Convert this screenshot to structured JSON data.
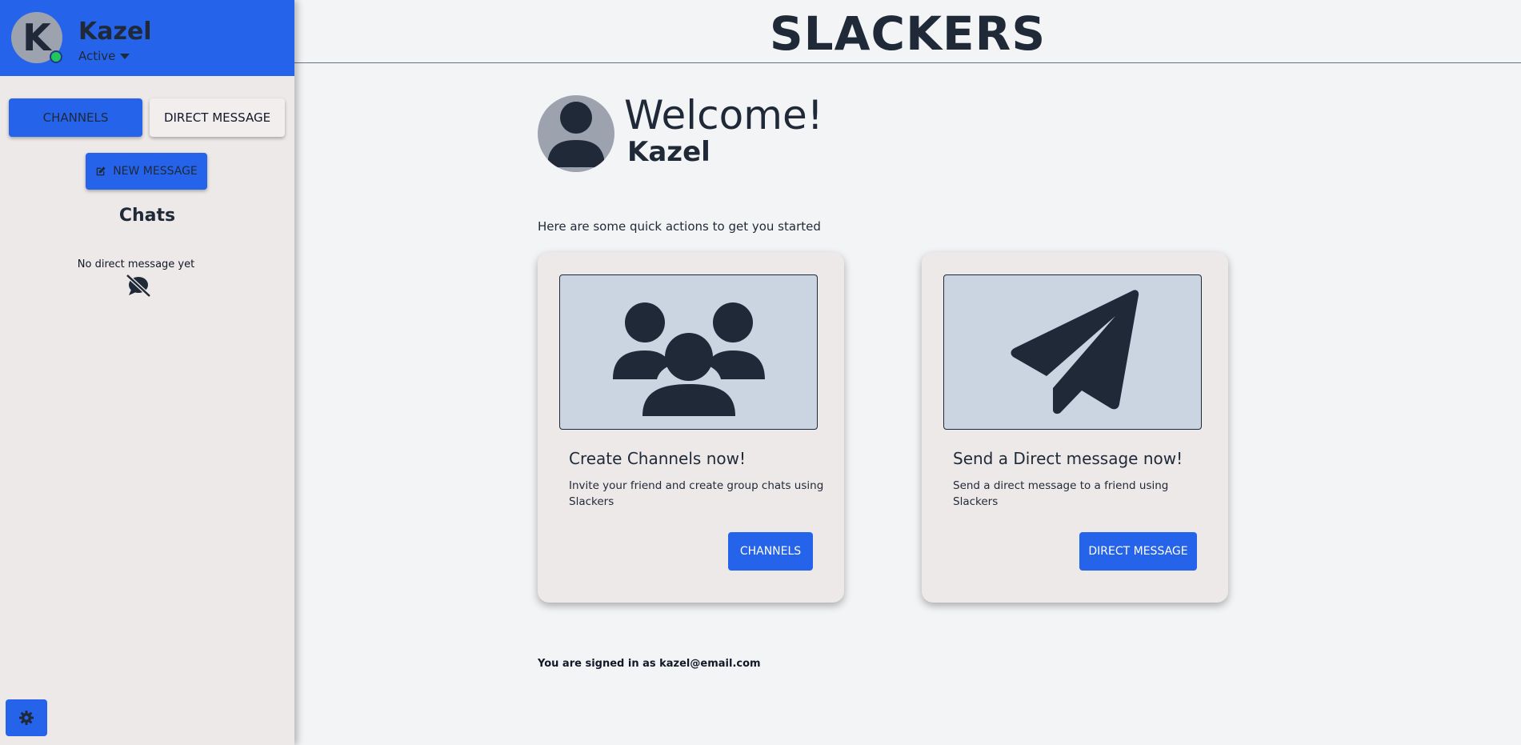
{
  "sidebar": {
    "profile": {
      "avatar_letter": "K",
      "name": "Kazel",
      "status": "Active"
    },
    "tabs": [
      {
        "label": "CHANNELS",
        "active": true
      },
      {
        "label": "DIRECT MESSAGE",
        "active": false
      }
    ],
    "new_message_label": "NEW MESSAGE",
    "chats_title": "Chats",
    "empty_text": "No direct message yet"
  },
  "main": {
    "app_title": "SLACKERS",
    "welcome": "Welcome!",
    "user_name": "Kazel",
    "quick_actions_text": "Here are some quick actions to get you started",
    "cards": [
      {
        "icon": "users-group-icon",
        "title": "Create Channels now!",
        "description": "Invite your friend and create group chats using Slackers",
        "button_label": "CHANNELS"
      },
      {
        "icon": "paper-plane-icon",
        "title": "Send a Direct message now!",
        "description": "Send a direct message to a friend using Slackers",
        "button_label": "DIRECT MESSAGE"
      }
    ],
    "signed_in_text": "You are signed in as kazel@email.com"
  },
  "colors": {
    "accent": "#2563eb",
    "status_online": "#22c55e",
    "card_bg": "#ede9e8",
    "image_bg": "#cbd5e1"
  }
}
